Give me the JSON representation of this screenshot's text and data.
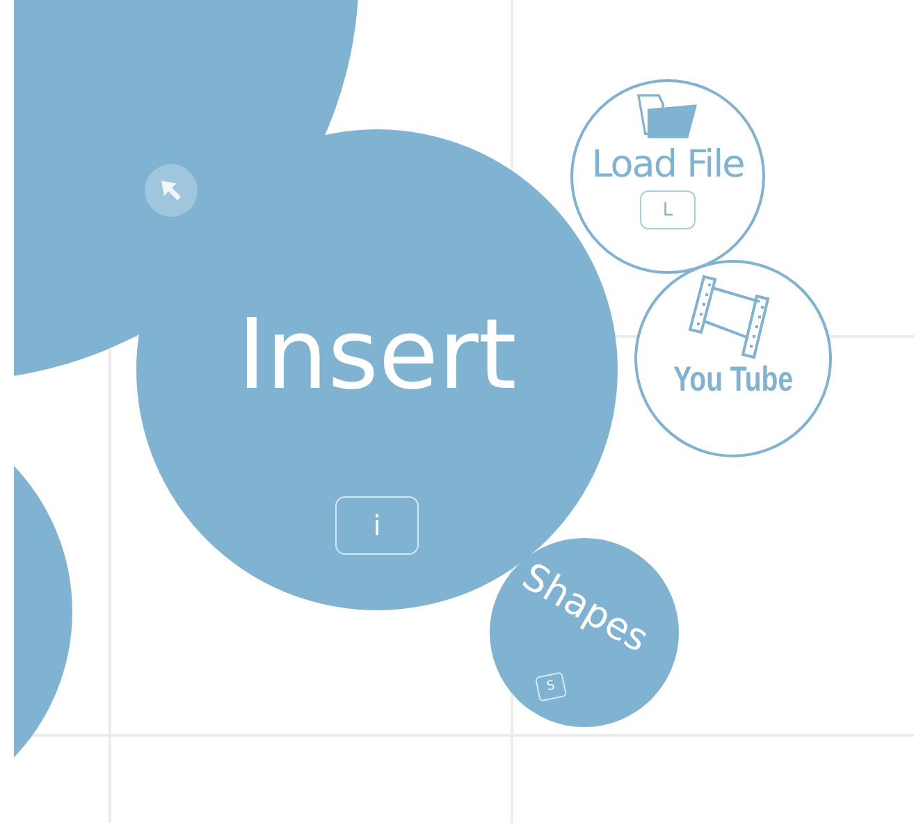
{
  "main": {
    "label": "Insert",
    "key": "i"
  },
  "options": [
    {
      "kind": "file",
      "label": "Load File",
      "key": "L"
    },
    {
      "kind": "video",
      "label": "You Tube"
    },
    {
      "kind": "shape",
      "label": "Shapes",
      "key": "S"
    }
  ]
}
